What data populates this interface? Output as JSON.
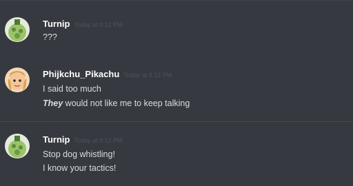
{
  "messages": [
    {
      "author": "Turnip",
      "timestamp": "Today at 9:12 PM",
      "lines": [
        "???"
      ]
    },
    {
      "author": "Phijkchu_Pikachu",
      "timestamp": "Today at 9:12 PM",
      "lines": [
        "I said too much"
      ],
      "styled_line": {
        "emphasis": "They",
        "rest": " would not like me to keep talking"
      }
    },
    {
      "author": "Turnip",
      "timestamp": "Today at 9:12 PM",
      "lines": [
        "Stop dog whistling!",
        "I know your tactics!"
      ]
    }
  ],
  "colors": {
    "background": "#36393f",
    "username": "#ffffff",
    "message_text": "#dcddde",
    "timestamp": "#4f5359",
    "new_messages_divider": "#6b3a3e"
  }
}
